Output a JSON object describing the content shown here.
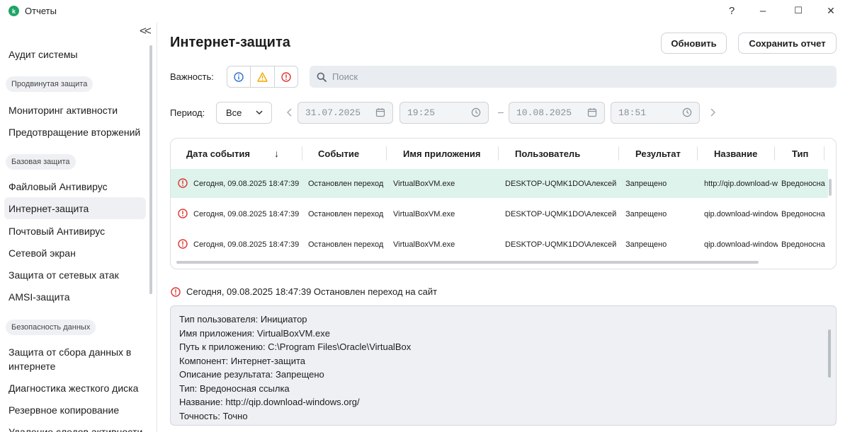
{
  "window": {
    "title": "Отчеты",
    "logo_letter": "k",
    "help_label": "?",
    "minimize_label": "–",
    "maximize_label": "☐",
    "close_label": "✕"
  },
  "sidebar": {
    "collapse_label": "<<",
    "items": [
      {
        "label": "Аудит системы"
      },
      {
        "section": "Продвинутая защита"
      },
      {
        "label": "Мониторинг активности"
      },
      {
        "label": "Предотвращение вторжений"
      },
      {
        "section": "Базовая защита"
      },
      {
        "label": "Файловый Антивирус"
      },
      {
        "label": "Интернет-защита",
        "active": true
      },
      {
        "label": "Почтовый Антивирус"
      },
      {
        "label": "Сетевой экран"
      },
      {
        "label": "Защита от сетевых атак"
      },
      {
        "label": "AMSI-защита"
      },
      {
        "section": "Безопасность данных"
      },
      {
        "label": "Защита от сбора данных в интернете"
      },
      {
        "label": "Диагностика жесткого диска"
      },
      {
        "label": "Резервное копирование"
      },
      {
        "label": "Удаление следов активности"
      }
    ]
  },
  "header": {
    "title": "Интернет-защита",
    "refresh_label": "Обновить",
    "save_label": "Сохранить отчет"
  },
  "filters": {
    "severity_label": "Важность:",
    "search_placeholder": "Поиск",
    "period_label": "Период:",
    "period_value": "Все",
    "date_from": "31.07.2025",
    "time_from": "19:25",
    "date_to": "10.08.2025",
    "time_to": "18:51",
    "range_dash": "–"
  },
  "table": {
    "columns": [
      "Дата события",
      "Событие",
      "Имя приложения",
      "Пользователь",
      "Результат",
      "Название",
      "Тип"
    ],
    "sort_arrow": "↓",
    "rows": [
      [
        "Сегодня, 09.08.2025 18:47:39",
        "Остановлен переход",
        "VirtualBoxVM.exe",
        "DESKTOP-UQMK1DO\\Алексей",
        "Запрещено",
        "http://qip.download-windows.org/",
        "Вредоносная ссылка"
      ],
      [
        "Сегодня, 09.08.2025 18:47:39",
        "Остановлен переход",
        "VirtualBoxVM.exe",
        "DESKTOP-UQMK1DO\\Алексей",
        "Запрещено",
        "qip.download-windows.org",
        "Вредоносная ссылка"
      ],
      [
        "Сегодня, 09.08.2025 18:47:39",
        "Остановлен переход",
        "VirtualBoxVM.exe",
        "DESKTOP-UQMK1DO\\Алексей",
        "Запрещено",
        "qip.download-windows.org",
        "Вредоносная ссылка"
      ]
    ]
  },
  "details": {
    "header": "Сегодня, 09.08.2025 18:47:39 Остановлен переход на сайт",
    "lines": [
      "Тип пользователя: Инициатор",
      "Имя приложения: VirtualBoxVM.exe",
      "Путь к приложению: C:\\Program Files\\Oracle\\VirtualBox",
      "Компонент: Интернет-защита",
      "Описание результата: Запрещено",
      "Тип: Вредоносная ссылка",
      "Название: http://qip.download-windows.org/",
      "Точность: Точно"
    ]
  },
  "colors": {
    "accent_green": "#1fa567",
    "selected_row": "#def3ec",
    "danger": "#e0332f",
    "warning": "#f2a900",
    "info": "#2f6fd6"
  }
}
